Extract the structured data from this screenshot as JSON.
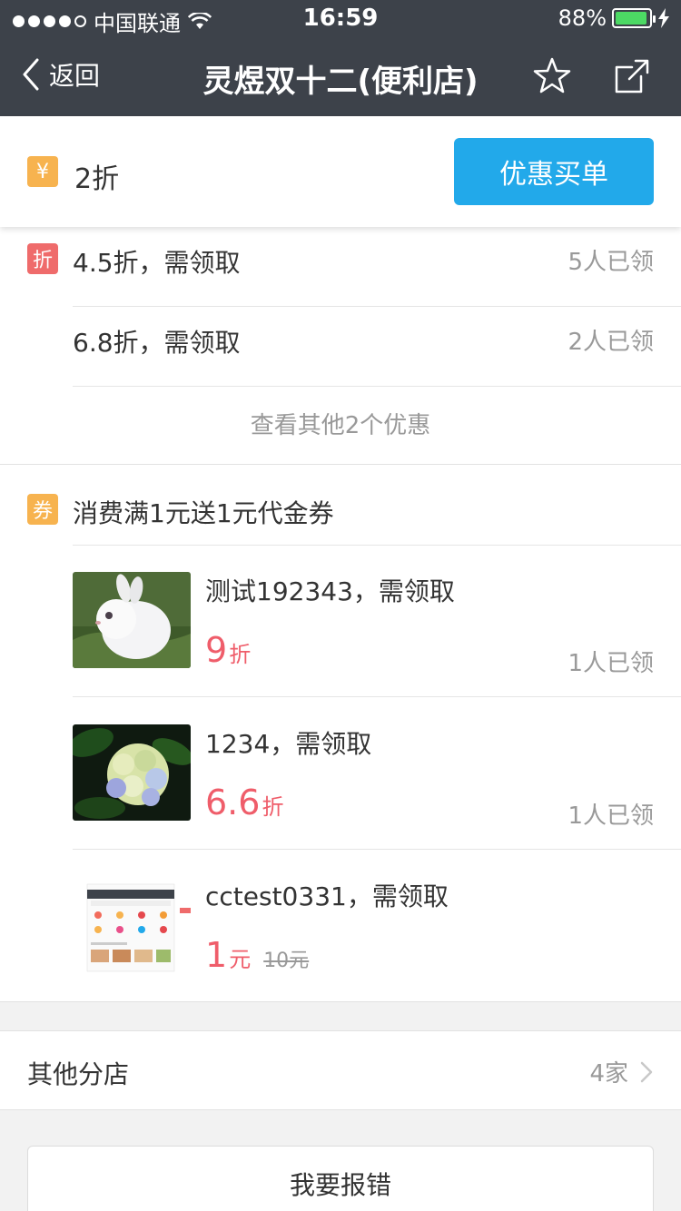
{
  "status_bar": {
    "carrier": "中国联通",
    "time": "16:59",
    "battery": "88%",
    "signal_bars": 4,
    "signal_total": 5,
    "battery_level": 0.88,
    "battery_color": "#4cd964"
  },
  "nav": {
    "back_label": "返回",
    "title": "灵煜双十二(便利店)",
    "icons": [
      "back-chevron-icon",
      "star-icon",
      "share-icon"
    ]
  },
  "top_discount": {
    "badge": "¥",
    "rate": "2折",
    "pay_button": "优惠买单",
    "button_color": "#22a9ea"
  },
  "discounts": {
    "badge": "折",
    "items": [
      {
        "text": "4.5折，需领取",
        "claimed": "5人已领"
      },
      {
        "text": "6.8折，需领取",
        "claimed": "2人已领"
      }
    ],
    "more_link": "查看其他2个优惠"
  },
  "coupons": {
    "badge": "券",
    "header": "消费满1元送1元代金券",
    "items": [
      {
        "name": "测试192343，需领取",
        "price": "9",
        "unit": "折",
        "original": "",
        "claimed": "1人已领",
        "image": "rabbit-photo"
      },
      {
        "name": "1234，需领取",
        "price": "6.6",
        "unit": "折",
        "original": "",
        "claimed": "1人已领",
        "image": "hydrangea-photo"
      },
      {
        "name": "cctest0331，需领取",
        "price": "1",
        "unit": "元",
        "original": "10元",
        "claimed": "",
        "image": "app-screenshot"
      }
    ],
    "price_color": "#ef5d6a"
  },
  "branches": {
    "label": "其他分店",
    "count": "4家"
  },
  "report_button": "我要报错"
}
